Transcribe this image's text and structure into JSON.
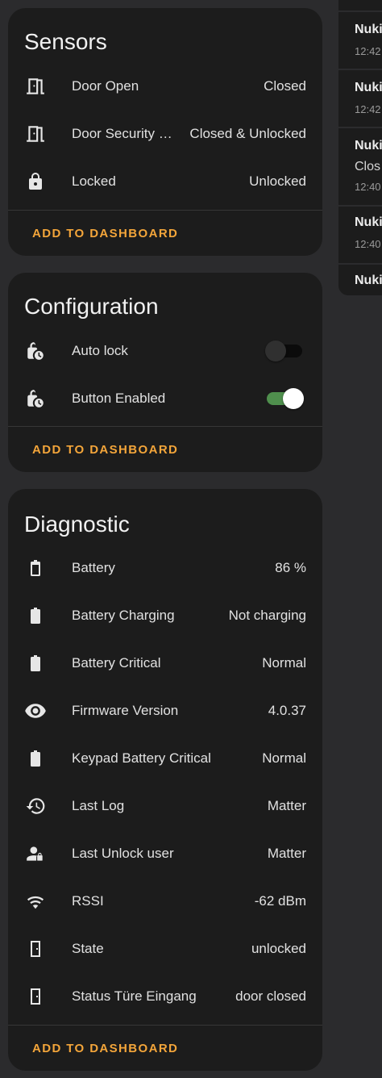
{
  "sensors": {
    "title": "Sensors",
    "rows": [
      {
        "label": "Door Open",
        "value": "Closed",
        "icon": "door-icon"
      },
      {
        "label": "Door Security St...",
        "value": "Closed & Unlocked",
        "icon": "door-icon"
      },
      {
        "label": "Locked",
        "value": "Unlocked",
        "icon": "lock-icon"
      }
    ],
    "action": "ADD TO DASHBOARD"
  },
  "configuration": {
    "title": "Configuration",
    "rows": [
      {
        "label": "Auto lock",
        "state": "off",
        "icon": "lock-clock-icon"
      },
      {
        "label": "Button Enabled",
        "state": "on",
        "icon": "lock-clock-icon"
      }
    ],
    "action": "ADD TO DASHBOARD"
  },
  "diagnostic": {
    "title": "Diagnostic",
    "rows": [
      {
        "label": "Battery",
        "value": "86 %",
        "icon": "battery-icon"
      },
      {
        "label": "Battery Charging",
        "value": "Not charging",
        "icon": "battery-icon"
      },
      {
        "label": "Battery Critical",
        "value": "Normal",
        "icon": "battery-icon"
      },
      {
        "label": "Firmware Version",
        "value": "4.0.37",
        "icon": "eye-icon"
      },
      {
        "label": "Keypad Battery Critical",
        "value": "Normal",
        "icon": "battery-icon"
      },
      {
        "label": "Last Log",
        "value": "Matter",
        "icon": "history-icon"
      },
      {
        "label": "Last Unlock user",
        "value": "Matter",
        "icon": "account-lock-icon"
      },
      {
        "label": "RSSI",
        "value": "-62 dBm",
        "icon": "wifi-icon"
      },
      {
        "label": "State",
        "value": "unlocked",
        "icon": "door-icon"
      },
      {
        "label": "Status Türe Eingang",
        "value": "door closed",
        "icon": "door-icon"
      }
    ],
    "action": "ADD TO DASHBOARD"
  },
  "logbook": {
    "entries": [
      {
        "name": "Nuki",
        "time": "12:42"
      },
      {
        "name": "Nuki",
        "time": "12:42"
      },
      {
        "name": "Nuki",
        "line2": "Clos",
        "time": "12:40"
      },
      {
        "name": "Nuki",
        "time": "12:40"
      },
      {
        "name": "Nuki"
      }
    ]
  },
  "colors": {
    "accent": "#f3a53a",
    "card": "#1c1c1c",
    "background": "#2b2b2d",
    "toggle_on": "#4f8f4d"
  }
}
